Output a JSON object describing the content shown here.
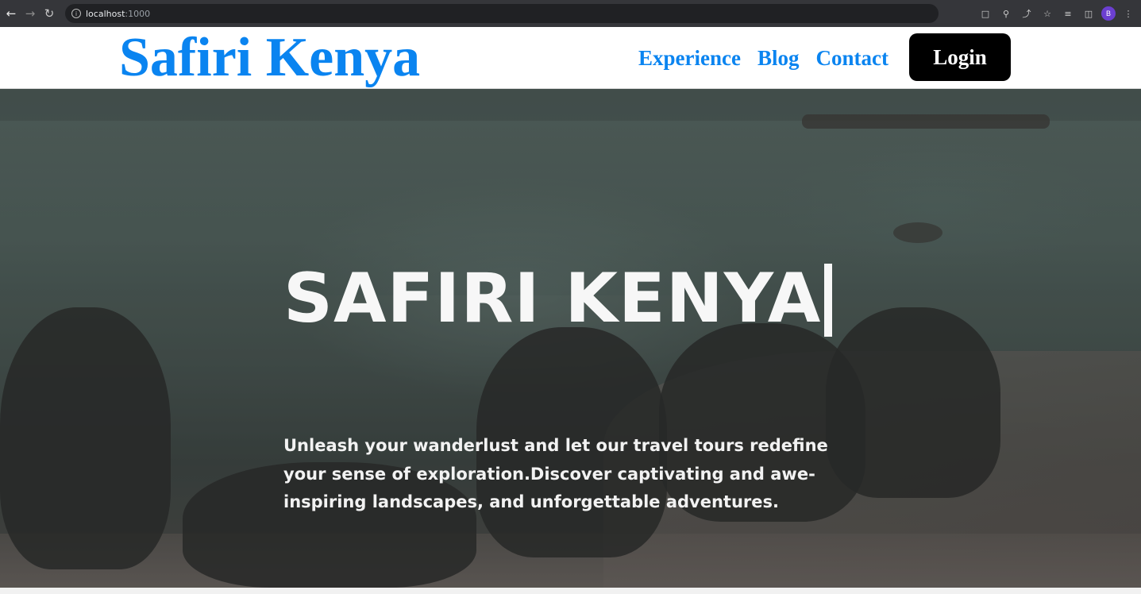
{
  "browser": {
    "url_host": "localhost",
    "url_port": ":1000",
    "profile_initial": "B",
    "icons": [
      "back-icon",
      "forward-icon",
      "reload-icon",
      "info-icon",
      "install-icon",
      "zoom-icon",
      "share-icon",
      "bookmark-star-icon",
      "reading-list-icon",
      "side-panel-icon",
      "menu-icon"
    ]
  },
  "header": {
    "logo": "Safiri Kenya",
    "nav": [
      {
        "label": "Experience"
      },
      {
        "label": "Blog"
      },
      {
        "label": "Contact"
      }
    ],
    "login_label": "Login"
  },
  "hero": {
    "title": "SAFIRI KENYA",
    "text": "Unleash your wanderlust and let our travel tours redefine your sense of exploration.Discover captivating and awe-inspiring landscapes, and unforgettable adventures."
  },
  "colors": {
    "brand_blue": "#0a84f0",
    "login_bg": "#000000",
    "hero_text": "#f7f7f7"
  }
}
